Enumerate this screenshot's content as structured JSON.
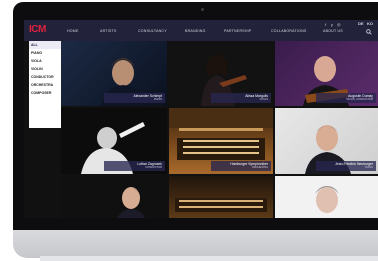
{
  "header": {
    "logo": "ICM",
    "nav": [
      "HOME",
      "ARTISTS",
      "CONSULTANCY",
      "BRANDING",
      "PARTNERSHIP",
      "COLLABORATIONS",
      "ABOUT US"
    ],
    "social": [
      "f",
      "y",
      "◎"
    ],
    "languages": [
      "DE",
      "KO"
    ]
  },
  "sidebar": {
    "items": [
      "ALL",
      "PIANO",
      "VIOLA",
      "VIOLIN",
      "CONDUCTOR",
      "ORCHESTRA",
      "COMPOSER"
    ]
  },
  "artists": [
    {
      "name": "Alexander Schimpf",
      "role": "PIANO"
    },
    {
      "name": "Alissa Margulis",
      "role": "VIOLIN"
    },
    {
      "name": "Augustin Dumay",
      "role": "VIOLIN, CONDUCTOR"
    },
    {
      "name": "Lothar Zagrosek",
      "role": "CONDUCTOR"
    },
    {
      "name": "Hamburger Symphoniker",
      "role": "ORCHESTRA"
    },
    {
      "name": "Jean-Frédéric Neuburger",
      "role": "PIANO"
    },
    {
      "name": "",
      "role": ""
    },
    {
      "name": "",
      "role": ""
    },
    {
      "name": "",
      "role": ""
    }
  ],
  "colors": {
    "header_bg": "#23223b",
    "logo": "#e0213d",
    "caption_bg": "#282650"
  }
}
